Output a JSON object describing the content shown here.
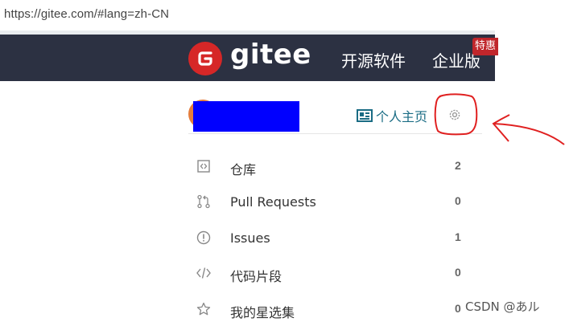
{
  "browser": {
    "url": "https://gitee.com/#lang=zh-CN"
  },
  "navbar": {
    "brand": "gitee",
    "links": [
      "开源软件",
      "企业版"
    ],
    "badge": "特惠"
  },
  "profile": {
    "home_label": "个人主页"
  },
  "menu": [
    {
      "label": "仓库",
      "count": "2",
      "icon": "repo-icon"
    },
    {
      "label": "Pull Requests",
      "count": "0",
      "icon": "pull-request-icon"
    },
    {
      "label": "Issues",
      "count": "1",
      "icon": "issue-icon"
    },
    {
      "label": "代码片段",
      "count": "0",
      "icon": "code-icon"
    },
    {
      "label": "我的星选集",
      "count": "0",
      "icon": "star-icon"
    }
  ],
  "watermark": "CSDN @あル",
  "colors": {
    "navbar": "#2c3142",
    "brand_red": "#d62727",
    "link": "#1a6c84",
    "annotation": "#e02020",
    "redaction": "#0000ff"
  }
}
